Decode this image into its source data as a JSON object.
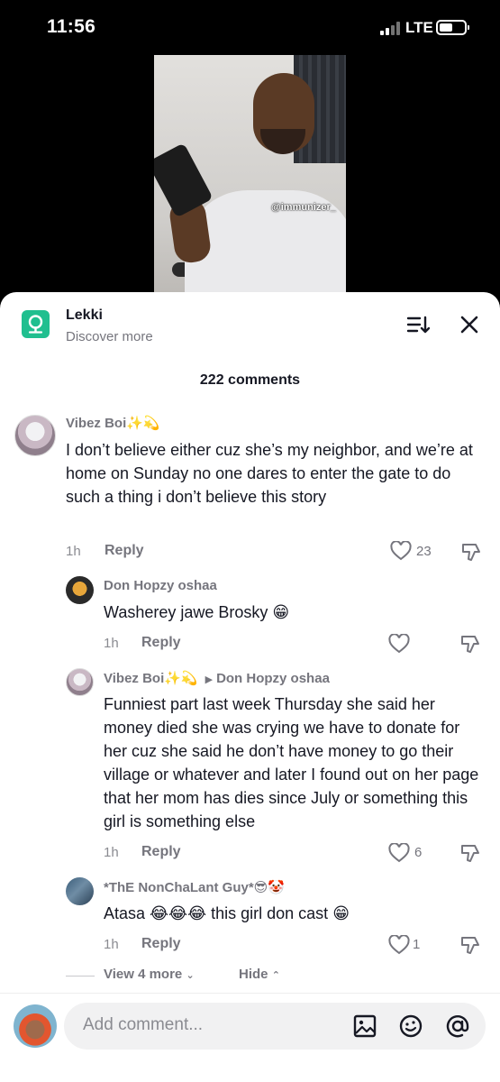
{
  "status_bar": {
    "time": "11:56",
    "network": "LTE",
    "battery_level": 0.45
  },
  "video": {
    "watermark": "@immunizer_"
  },
  "location_header": {
    "title": "Lekki",
    "subtitle": "Discover more"
  },
  "comments_count": "222 comments",
  "comments": [
    {
      "author": "Vibez Boi✨💫",
      "text": "I don’t believe either cuz she’s my neighbor, and we’re at home on Sunday no one dares to enter the gate to do such a thing i don’t believe this story",
      "time": "1h",
      "reply_label": "Reply",
      "likes": "23"
    }
  ],
  "replies": [
    {
      "author": "Don Hopzy oshaa",
      "text": "Washerey jawe Brosky 😁",
      "time": "1h",
      "reply_label": "Reply",
      "likes": ""
    },
    {
      "author": "Vibez Boi✨💫",
      "reply_to": "Don Hopzy oshaa",
      "text": "Funniest part last week Thursday she said her money died she was crying we have to donate for her cuz she said he don’t have money to go their village or whatever and later I found out on her page that her mom has dies since July or something this girl is something else",
      "time": "1h",
      "reply_label": "Reply",
      "likes": "6"
    },
    {
      "author": "*ThE NonChaLant Guy*😎🤡",
      "text": "Atasa 😂😂😂 this girl don cast 😁",
      "time": "1h",
      "reply_label": "Reply",
      "likes": "1"
    }
  ],
  "thread_controls": {
    "view_more": "View 4 more",
    "hide": "Hide"
  },
  "composer": {
    "placeholder": "Add comment..."
  },
  "icons": [
    "location-pin-icon",
    "sort-icon",
    "close-icon",
    "like-heart-icon",
    "dislike-icon",
    "image-icon",
    "emoji-icon",
    "mention-icon",
    "chevron-down-icon",
    "chevron-up-icon"
  ],
  "colors": {
    "accent_green": "#20bf8f",
    "text_primary": "#161823",
    "text_secondary": "#75757d"
  }
}
